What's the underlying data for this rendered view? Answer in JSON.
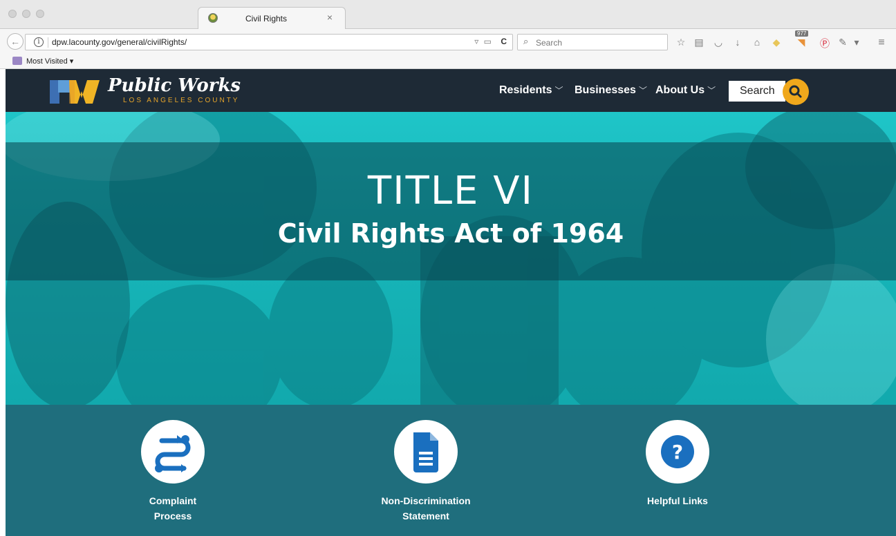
{
  "browser": {
    "tab_title": "Civil Rights",
    "url": "dpw.lacounty.gov/general/civilRights/",
    "search_placeholder": "Search",
    "bookmark_label": "Most Visited",
    "badge_count": "977"
  },
  "site": {
    "logo_title": "Public Works",
    "logo_subtitle": "LOS ANGELES COUNTY",
    "nav": [
      "Residents",
      "Businesses",
      "About Us"
    ],
    "search_label": "Search",
    "accent_color": "#f0a81c",
    "header_color": "#1e2a36"
  },
  "hero": {
    "title": "TITLE VI",
    "subtitle": "Civil Rights Act of 1964",
    "tint_color": "#1fc5c8"
  },
  "cards": [
    {
      "line1": "Complaint",
      "line2": "Process",
      "icon": "process-arrows-icon"
    },
    {
      "line1": "Non-Discrimination",
      "line2": "Statement",
      "icon": "document-icon"
    },
    {
      "line1": "Helpful Links",
      "line2": "",
      "icon": "question-icon"
    }
  ],
  "section_color": "#1f6e7d"
}
